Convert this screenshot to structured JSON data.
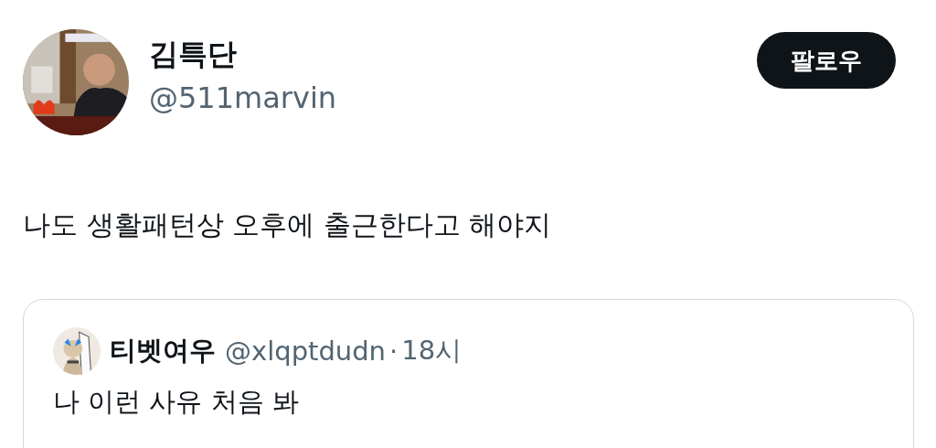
{
  "author": {
    "name": "김특단",
    "handle": "@511marvin"
  },
  "follow_button": {
    "label": "팔로우"
  },
  "tweet_text": "나도 생활패턴상 오후에 출근한다고 해야지",
  "quoted_tweet": {
    "author": {
      "name": "티벳여우",
      "handle": "@xlqptdudn"
    },
    "separator": "·",
    "time": "18시",
    "text": "나 이런 사유 처음 봐"
  }
}
